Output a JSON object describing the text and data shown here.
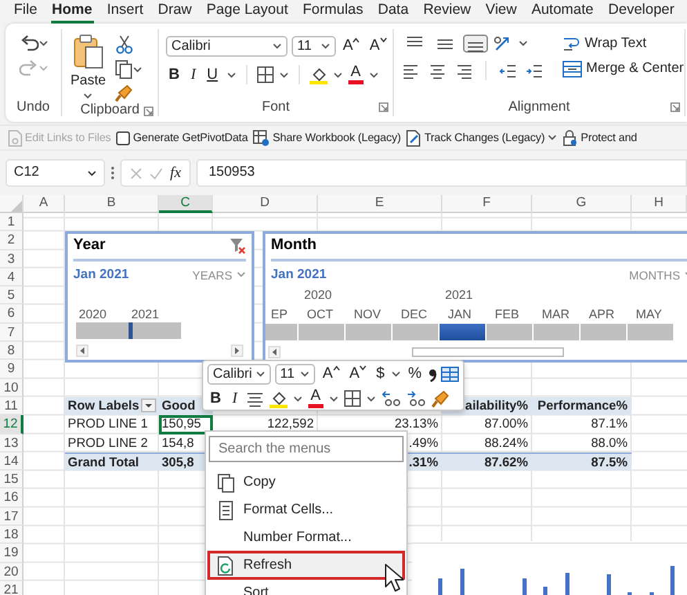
{
  "menu_tabs": [
    {
      "label": "File",
      "selected": false
    },
    {
      "label": "Home",
      "selected": true
    },
    {
      "label": "Insert",
      "selected": false
    },
    {
      "label": "Draw",
      "selected": false
    },
    {
      "label": "Page Layout",
      "selected": false
    },
    {
      "label": "Formulas",
      "selected": false
    },
    {
      "label": "Data",
      "selected": false
    },
    {
      "label": "Review",
      "selected": false
    },
    {
      "label": "View",
      "selected": false
    },
    {
      "label": "Automate",
      "selected": false
    },
    {
      "label": "Developer",
      "selected": false
    }
  ],
  "ribbon": {
    "undo": {
      "label": "Undo",
      "redo_disabled": true
    },
    "clipboard": {
      "label": "Clipboard",
      "paste": "Paste"
    },
    "font": {
      "label": "Font",
      "font_name": "Calibri",
      "font_size": "11",
      "grow": "A",
      "shrink": "A",
      "bold": "B",
      "italic": "I",
      "underline": "U",
      "font_color": "A"
    },
    "alignment": {
      "label": "Alignment",
      "vertical": [
        {
          "selected": false
        },
        {
          "selected": false
        },
        {
          "selected": true
        }
      ],
      "wrap_text": "Wrap Text",
      "merge": "Merge & Center"
    }
  },
  "toolbar": [
    {
      "kind": "links",
      "label": "Edit Links to Files",
      "disabled": true
    },
    {
      "kind": "checkbox",
      "label": "Generate GetPivotData",
      "checked": false
    },
    {
      "kind": "share",
      "label": "Share Workbook (Legacy)"
    },
    {
      "kind": "track",
      "label": "Track Changes (Legacy)"
    },
    {
      "kind": "protect",
      "label": "Protect and"
    }
  ],
  "formula_bar": {
    "name_box": "C12",
    "function_label": "fx",
    "formula": "150953"
  },
  "columns": [
    {
      "label": "A",
      "selected": false
    },
    {
      "label": "B",
      "selected": false
    },
    {
      "label": "C",
      "selected": true
    },
    {
      "label": "D",
      "selected": false
    },
    {
      "label": "E",
      "selected": false
    },
    {
      "label": "F",
      "selected": false
    },
    {
      "label": "G",
      "selected": false
    },
    {
      "label": "H",
      "selected": false
    }
  ],
  "rows": [
    {
      "label": "1",
      "selected": false
    },
    {
      "label": "2",
      "selected": false
    },
    {
      "label": "3",
      "selected": false
    },
    {
      "label": "4",
      "selected": false
    },
    {
      "label": "5",
      "selected": false
    },
    {
      "label": "6",
      "selected": false
    },
    {
      "label": "7",
      "selected": false
    },
    {
      "label": "8",
      "selected": false
    },
    {
      "label": "9",
      "selected": false
    },
    {
      "label": "10",
      "selected": false
    },
    {
      "label": "11",
      "selected": false
    },
    {
      "label": "12",
      "selected": true
    },
    {
      "label": "13",
      "selected": false
    },
    {
      "label": "14",
      "selected": false
    },
    {
      "label": "15",
      "selected": false
    },
    {
      "label": "16",
      "selected": false
    },
    {
      "label": "17",
      "selected": false
    },
    {
      "label": "18",
      "selected": false
    },
    {
      "label": "19",
      "selected": false
    },
    {
      "label": "20",
      "selected": false
    },
    {
      "label": "21",
      "selected": false
    }
  ],
  "year_slicer": {
    "title": "Year",
    "selection": "Jan 2021",
    "period_label": "YEARS",
    "years": [
      {
        "label": "2020",
        "selected": false
      },
      {
        "label": "2021",
        "selected": true
      }
    ]
  },
  "month_slicer": {
    "title": "Month",
    "selection": "Jan 2021",
    "period_label": "MONTHS",
    "months": [
      {
        "label": "EP",
        "selected": false
      },
      {
        "label": "OCT",
        "year": "2020",
        "selected": false
      },
      {
        "label": "NOV",
        "selected": false
      },
      {
        "label": "DEC",
        "selected": false
      },
      {
        "label": "JAN",
        "year": "2021",
        "selected": true
      },
      {
        "label": "FEB",
        "selected": false
      },
      {
        "label": "MAR",
        "selected": false
      },
      {
        "label": "APR",
        "selected": false
      },
      {
        "label": "MAY",
        "selected": false
      }
    ]
  },
  "pivot_table": {
    "header": {
      "row_labels": "Row Labels",
      "col_c": "Good",
      "col_f": "ailability%",
      "col_g": "Performance%"
    },
    "rows": [
      {
        "kind": "item",
        "active": true,
        "label": "PROD LINE 1",
        "col_c": "150,95",
        "col_d": "122,592",
        "col_e": "23.13%",
        "col_f": "87.00%",
        "col_g": "87.1%"
      },
      {
        "kind": "item",
        "active": false,
        "label": "PROD LINE 2",
        "col_c": "154,8",
        "col_e": ".49%",
        "col_f": "88.24%",
        "col_g": "88.0%"
      },
      {
        "kind": "total",
        "active": false,
        "label": "Grand Total",
        "col_c": "305,8",
        "col_e": ".31%",
        "col_f": "87.62%",
        "col_g": "87.5%"
      }
    ]
  },
  "mini_toolbar": {
    "font_name": "Calibri",
    "font_size": "11",
    "grow": "A",
    "shrink": "A",
    "currency": "$",
    "percent": "%",
    "bold": "B",
    "italic": "I",
    "font_color": "A"
  },
  "context_menu": {
    "search_placeholder": "Search the menus",
    "items": [
      {
        "kind": "copy",
        "label": "Copy",
        "highlighted": false
      },
      {
        "kind": "format",
        "label": "Format Cells...",
        "highlighted": false
      },
      {
        "kind": "plain",
        "label": "Number Format...",
        "highlighted": false
      },
      {
        "kind": "refresh",
        "label": "Refresh",
        "highlighted": true
      },
      {
        "kind": "plain",
        "label": "Sort",
        "highlighted": false
      }
    ]
  }
}
